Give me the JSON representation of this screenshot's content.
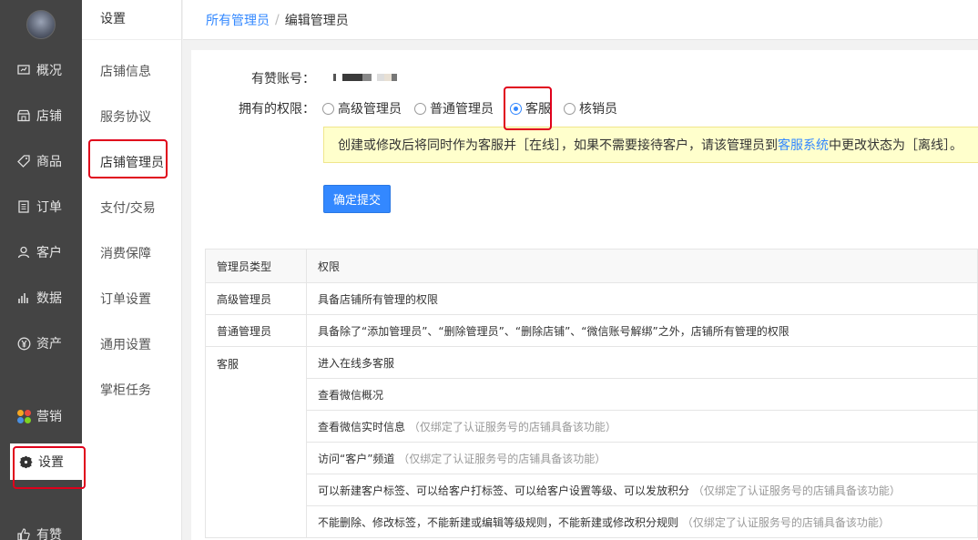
{
  "nav": {
    "items": [
      {
        "label": "概况",
        "icon": "dashboard-icon"
      },
      {
        "label": "店铺",
        "icon": "store-icon"
      },
      {
        "label": "商品",
        "icon": "tag-icon"
      },
      {
        "label": "订单",
        "icon": "order-icon"
      },
      {
        "label": "客户",
        "icon": "user-icon"
      },
      {
        "label": "数据",
        "icon": "chart-icon"
      },
      {
        "label": "资产",
        "icon": "yen-icon"
      },
      {
        "label": "营销",
        "icon": "marketing-icon"
      },
      {
        "label": "设置",
        "icon": "gear-icon"
      },
      {
        "label": "有赞",
        "icon": "thumb-up-icon"
      }
    ],
    "active": "设置"
  },
  "subnav": {
    "title": "设置",
    "items": [
      "店铺信息",
      "服务协议",
      "店铺管理员",
      "支付/交易",
      "消费保障",
      "订单设置",
      "通用设置",
      "掌柜任务"
    ],
    "active": "店铺管理员"
  },
  "breadcrumb": {
    "parent": "所有管理员",
    "separator": "/",
    "current": "编辑管理员"
  },
  "form": {
    "account_label": "有赞账号：",
    "permission_label": "拥有的权限：",
    "roles": [
      "高级管理员",
      "普通管理员",
      "客服",
      "核销员"
    ],
    "selected_role": "客服",
    "notice_before": "创建或修改后将同时作为客服并［在线］，如果不需要接待客户，请该管理员到",
    "notice_link": "客服系统",
    "notice_after": "中更改状态为［离线］。",
    "submit_label": "确定提交"
  },
  "table": {
    "headers": [
      "管理员类型",
      "权限"
    ],
    "rows": [
      {
        "type": "高级管理员",
        "perm": "具备店铺所有管理的权限",
        "note": ""
      },
      {
        "type": "普通管理员",
        "perm": "具备除了“添加管理员”、“删除管理员”、“删除店铺”、“微信账号解绑”之外，店铺所有管理的权限",
        "note": ""
      },
      {
        "type": "客服",
        "perm": "进入在线多客服",
        "note": ""
      },
      {
        "type": "",
        "perm": "查看微信概况",
        "note": ""
      },
      {
        "type": "",
        "perm": "查看微信实时信息",
        "note": "（仅绑定了认证服务号的店铺具备该功能）"
      },
      {
        "type": "",
        "perm": "访问“客户”频道",
        "note": "（仅绑定了认证服务号的店铺具备该功能）"
      },
      {
        "type": "",
        "perm": "可以新建客户标签、可以给客户打标签、可以给客户设置等级、可以发放积分",
        "note": "（仅绑定了认证服务号的店铺具备该功能）"
      },
      {
        "type": "",
        "perm": "不能删除、修改标签，不能新建或编辑等级规则，不能新建或修改积分规则",
        "note": "（仅绑定了认证服务号的店铺具备该功能）"
      }
    ]
  },
  "colors": {
    "accent": "#3388ff",
    "nav_bg": "#444444",
    "highlight": "#e0001b",
    "notice_bg": "#ffffcc"
  }
}
